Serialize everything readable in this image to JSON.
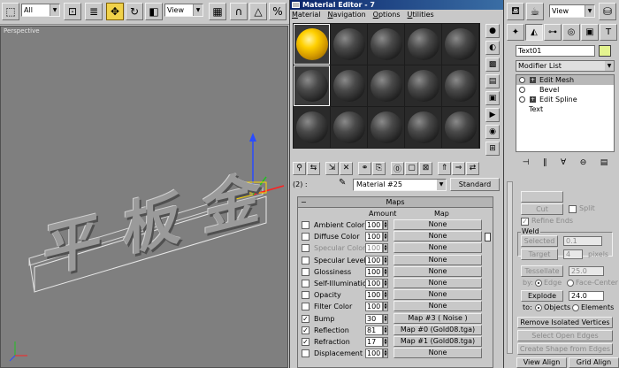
{
  "toolbar": {
    "selection_filter": "All",
    "coord_system": "View",
    "percent_snap": "%"
  },
  "viewport": {
    "label": "Perspective",
    "text_object_glyphs": [
      "平",
      "板",
      "金"
    ]
  },
  "material_editor": {
    "title": "Material Editor - 7",
    "menu": [
      "Material",
      "Navigation",
      "Options",
      "Utilities"
    ],
    "slot_index_label": "(2) :",
    "material_name": "Material #25",
    "material_type": "Standard",
    "maps_title": "Maps",
    "columns": {
      "amount": "Amount",
      "map": "Map"
    },
    "maps": [
      {
        "name": "Ambient Color",
        "checked": false,
        "amount": "100",
        "map": "None",
        "dim": false
      },
      {
        "name": "Diffuse Color",
        "checked": false,
        "amount": "100",
        "map": "None",
        "dim": false
      },
      {
        "name": "Specular Color",
        "checked": false,
        "amount": "100",
        "map": "None",
        "dim": true
      },
      {
        "name": "Specular Level",
        "checked": false,
        "amount": "100",
        "map": "None",
        "dim": false
      },
      {
        "name": "Glossiness",
        "checked": false,
        "amount": "100",
        "map": "None",
        "dim": false
      },
      {
        "name": "Self-Illumination",
        "checked": false,
        "amount": "100",
        "map": "None",
        "dim": false
      },
      {
        "name": "Opacity",
        "checked": false,
        "amount": "100",
        "map": "None",
        "dim": false
      },
      {
        "name": "Filter Color",
        "checked": false,
        "amount": "100",
        "map": "None",
        "dim": false
      },
      {
        "name": "Bump",
        "checked": true,
        "amount": "30",
        "map": "Map #3  ( Noise )",
        "dim": false
      },
      {
        "name": "Reflection",
        "checked": true,
        "amount": "81",
        "map": "Map #0 (Gold08.tga)",
        "dim": false
      },
      {
        "name": "Refraction",
        "checked": true,
        "amount": "17",
        "map": "Map #1 (Gold08.tga)",
        "dim": false
      },
      {
        "name": "Displacement",
        "checked": false,
        "amount": "100",
        "map": "None",
        "dim": false
      }
    ]
  },
  "command_panel": {
    "coord_combo": "View",
    "object_name": "Text01",
    "modifier_list": "Modifier List",
    "stack": [
      {
        "label": "Edit Mesh",
        "selected": true,
        "has_box": true,
        "has_bulb": true
      },
      {
        "label": "Bevel",
        "selected": false,
        "has_box": false,
        "has_bulb": true
      },
      {
        "label": "Edit Spline",
        "selected": false,
        "has_box": true,
        "has_bulb": true
      },
      {
        "label": "Text",
        "selected": false,
        "has_box": false,
        "has_bulb": false
      }
    ],
    "edit_geometry": {
      "cut": "Cut",
      "split": "Split",
      "refine_ends": "Refine Ends",
      "weld_title": "Weld",
      "selected_btn": "Selected",
      "selected_val": "0.1",
      "target_btn": "Target",
      "target_val": "4",
      "pixels": "pixels",
      "tessellate_btn": "Tessellate",
      "tessellate_val": "25.0",
      "by_label": "by:",
      "edge": "Edge",
      "face_center": "Face-Center",
      "explode_btn": "Explode",
      "explode_val": "24.0",
      "to_label": "to:",
      "objects": "Objects",
      "elements": "Elements",
      "remove_isolated": "Remove Isolated Vertices",
      "select_open_edges": "Select Open Edges",
      "create_shape": "Create Shape from Edges",
      "view_align": "View Align",
      "grid_align": "Grid Align"
    }
  }
}
